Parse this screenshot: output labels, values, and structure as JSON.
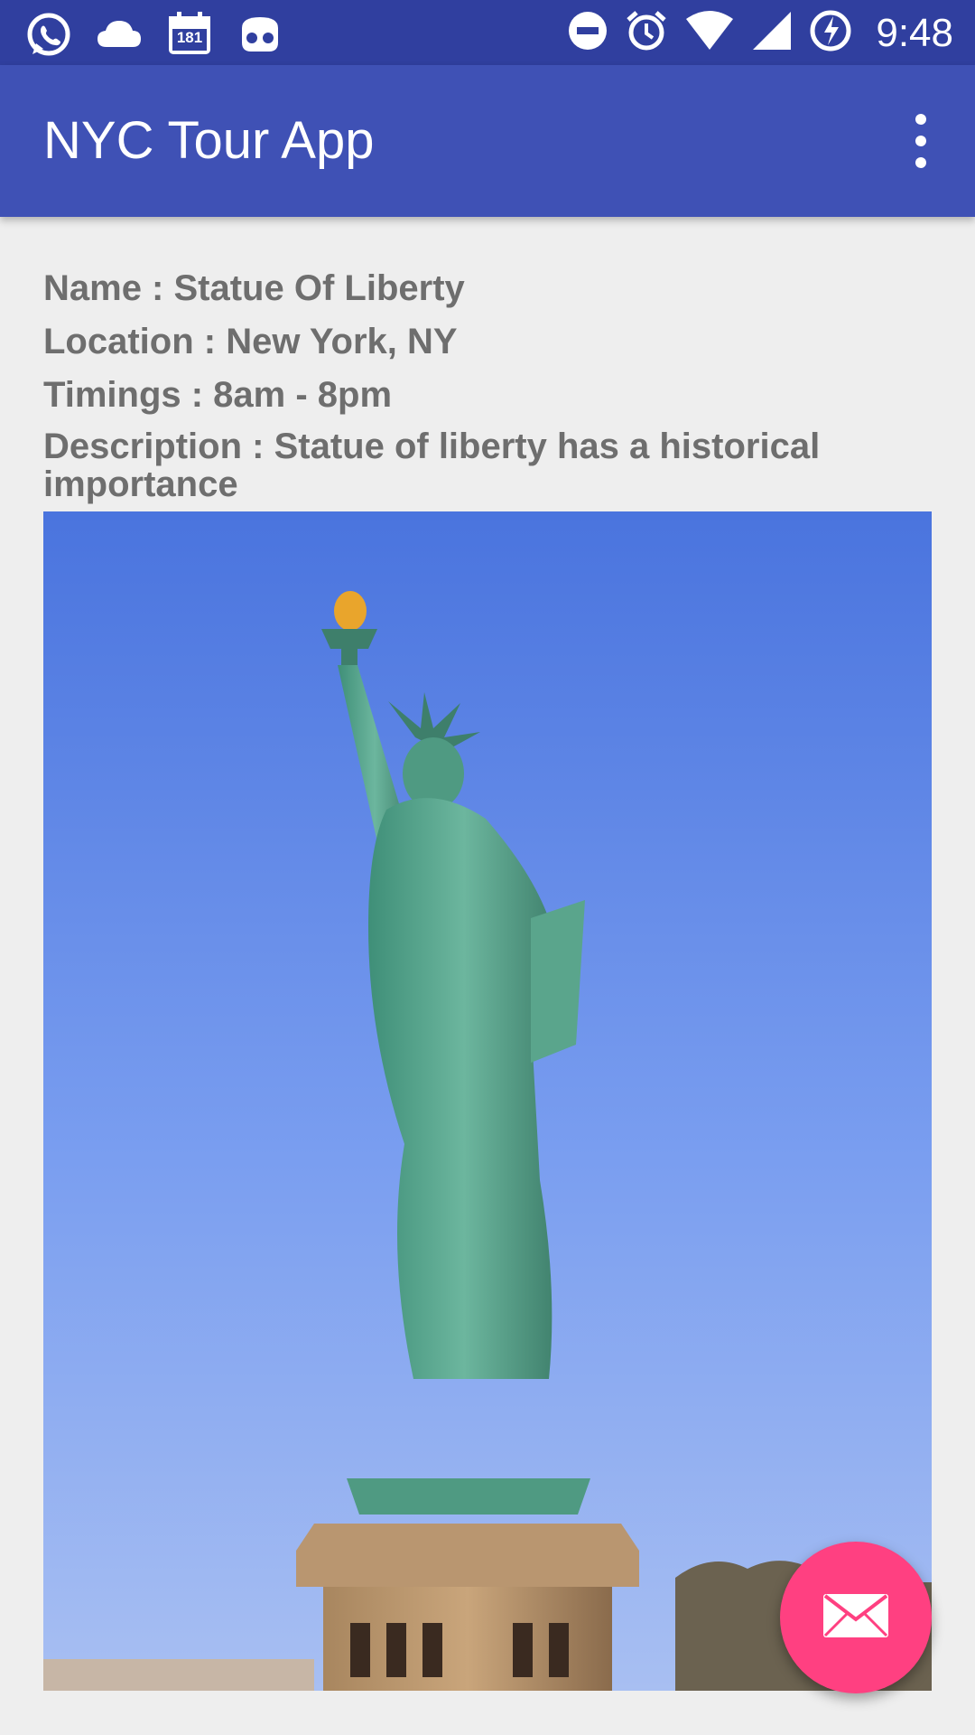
{
  "status_bar": {
    "time": "9:48",
    "notification_count": "181",
    "left_icons": [
      "whatsapp-icon",
      "cloud-icon",
      "calendar-icon",
      "incognito-icon"
    ],
    "right_icons": [
      "do-not-disturb-icon",
      "alarm-icon",
      "wifi-icon",
      "signal-icon",
      "battery-charging-icon"
    ]
  },
  "app_bar": {
    "title": "NYC Tour App",
    "menu_icon": "more-vert-icon"
  },
  "place": {
    "name": "Name : Statue Of Liberty",
    "location": "Location : New York, NY",
    "timings": "Timings : 8am - 8pm",
    "description": "Description : Statue of liberty has a historical importance"
  },
  "fab": {
    "icon": "email-icon"
  },
  "colors": {
    "status_bar": "#303f9f",
    "primary": "#3f51b5",
    "accent": "#ff4081",
    "text": "#6e6e6e",
    "background": "#eeeeee"
  }
}
